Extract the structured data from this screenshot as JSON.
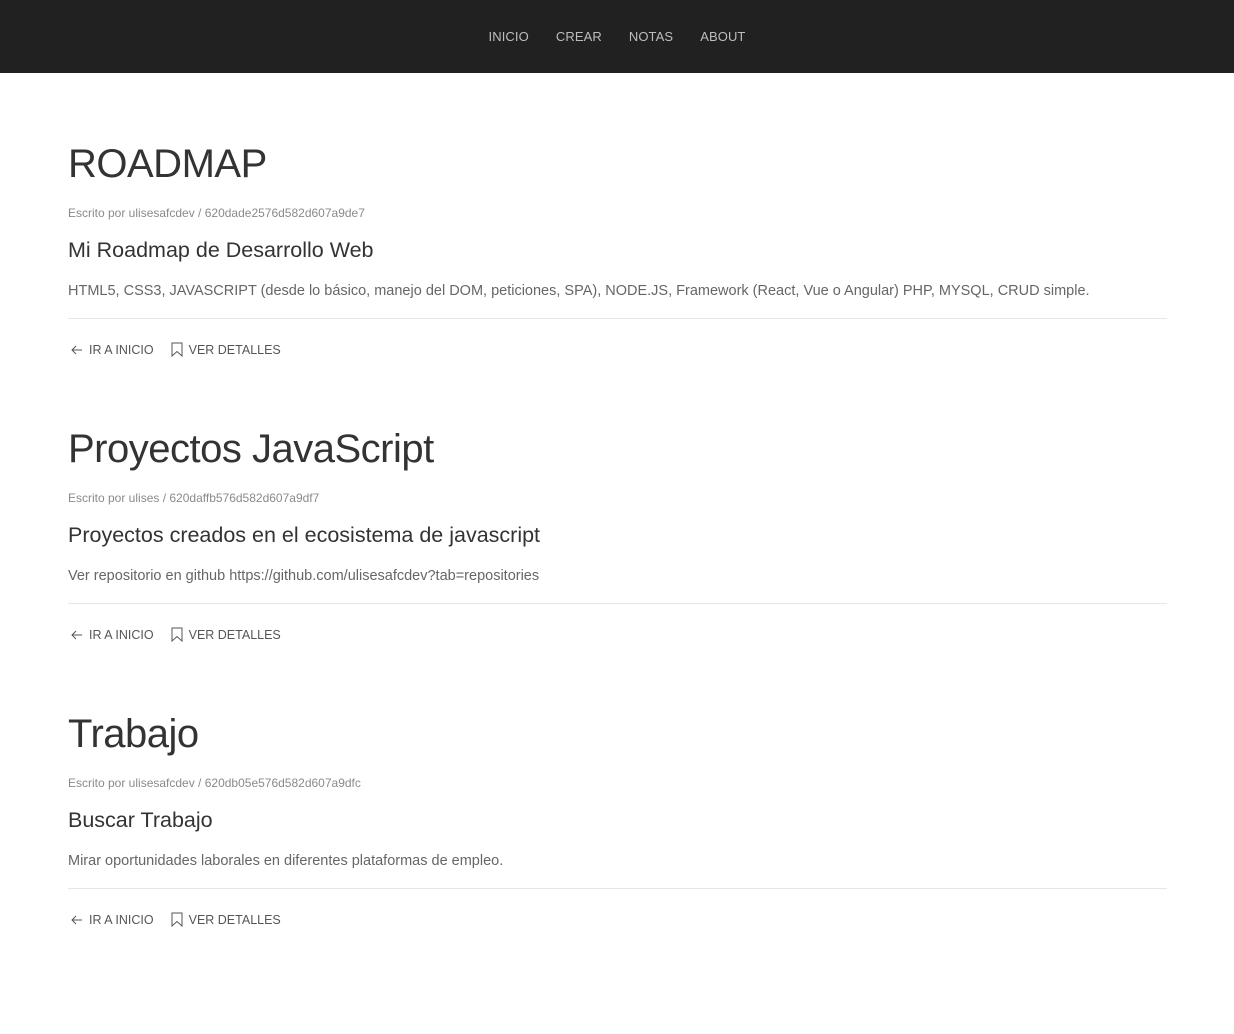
{
  "nav": {
    "items": [
      {
        "label": "INICIO"
      },
      {
        "label": "CREAR"
      },
      {
        "label": "NOTAS"
      },
      {
        "label": "ABOUT"
      }
    ]
  },
  "posts": [
    {
      "title": "ROADMAP",
      "meta": "Escrito por ulisesafcdev / 620dade2576d582d607a9de7",
      "subtitle": "Mi Roadmap de Desarrollo Web",
      "body": "HTML5, CSS3, JAVASCRIPT (desde lo básico, manejo del DOM, peticiones, SPA), NODE.JS, Framework (React, Vue o Angular) PHP, MYSQL, CRUD simple.",
      "home_label": "IR A INICIO",
      "details_label": "VER DETALLES"
    },
    {
      "title": "Proyectos JavaScript",
      "meta": "Escrito por ulises / 620daffb576d582d607a9df7",
      "subtitle": "Proyectos creados en el ecosistema de javascript",
      "body": "Ver repositorio en github https://github.com/ulisesafcdev?tab=repositories",
      "home_label": "IR A INICIO",
      "details_label": "VER DETALLES"
    },
    {
      "title": "Trabajo",
      "meta": "Escrito por ulisesafcdev / 620db05e576d582d607a9dfc",
      "subtitle": "Buscar Trabajo",
      "body": "Mirar oportunidades laborales en diferentes plataformas de empleo.",
      "home_label": "IR A INICIO",
      "details_label": "VER DETALLES"
    }
  ],
  "icons": {
    "home": "arrow-left-icon",
    "details": "bookmark-icon"
  }
}
